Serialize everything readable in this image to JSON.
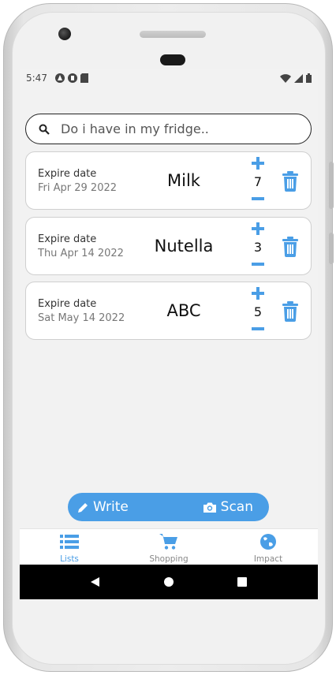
{
  "status": {
    "time": "5:47"
  },
  "search": {
    "placeholder": "Do i have in my fridge.."
  },
  "items": [
    {
      "expire_label": "Expire date",
      "expire_date": "Fri Apr 29 2022",
      "name": "Milk",
      "quantity": "7"
    },
    {
      "expire_label": "Expire date",
      "expire_date": "Thu Apr 14 2022",
      "name": "Nutella",
      "quantity": "3"
    },
    {
      "expire_label": "Expire date",
      "expire_date": "Sat May 14 2022",
      "name": "ABC",
      "quantity": "5"
    }
  ],
  "actions": {
    "write_label": "Write",
    "scan_label": "Scan"
  },
  "tabs": [
    {
      "label": "Lists",
      "icon": "list-icon",
      "active": true
    },
    {
      "label": "Shopping",
      "icon": "cart-icon",
      "active": false
    },
    {
      "label": "Impact",
      "icon": "globe-icon",
      "active": false
    }
  ],
  "colors": {
    "accent": "#4a9ee6",
    "inactive": "#888888"
  }
}
